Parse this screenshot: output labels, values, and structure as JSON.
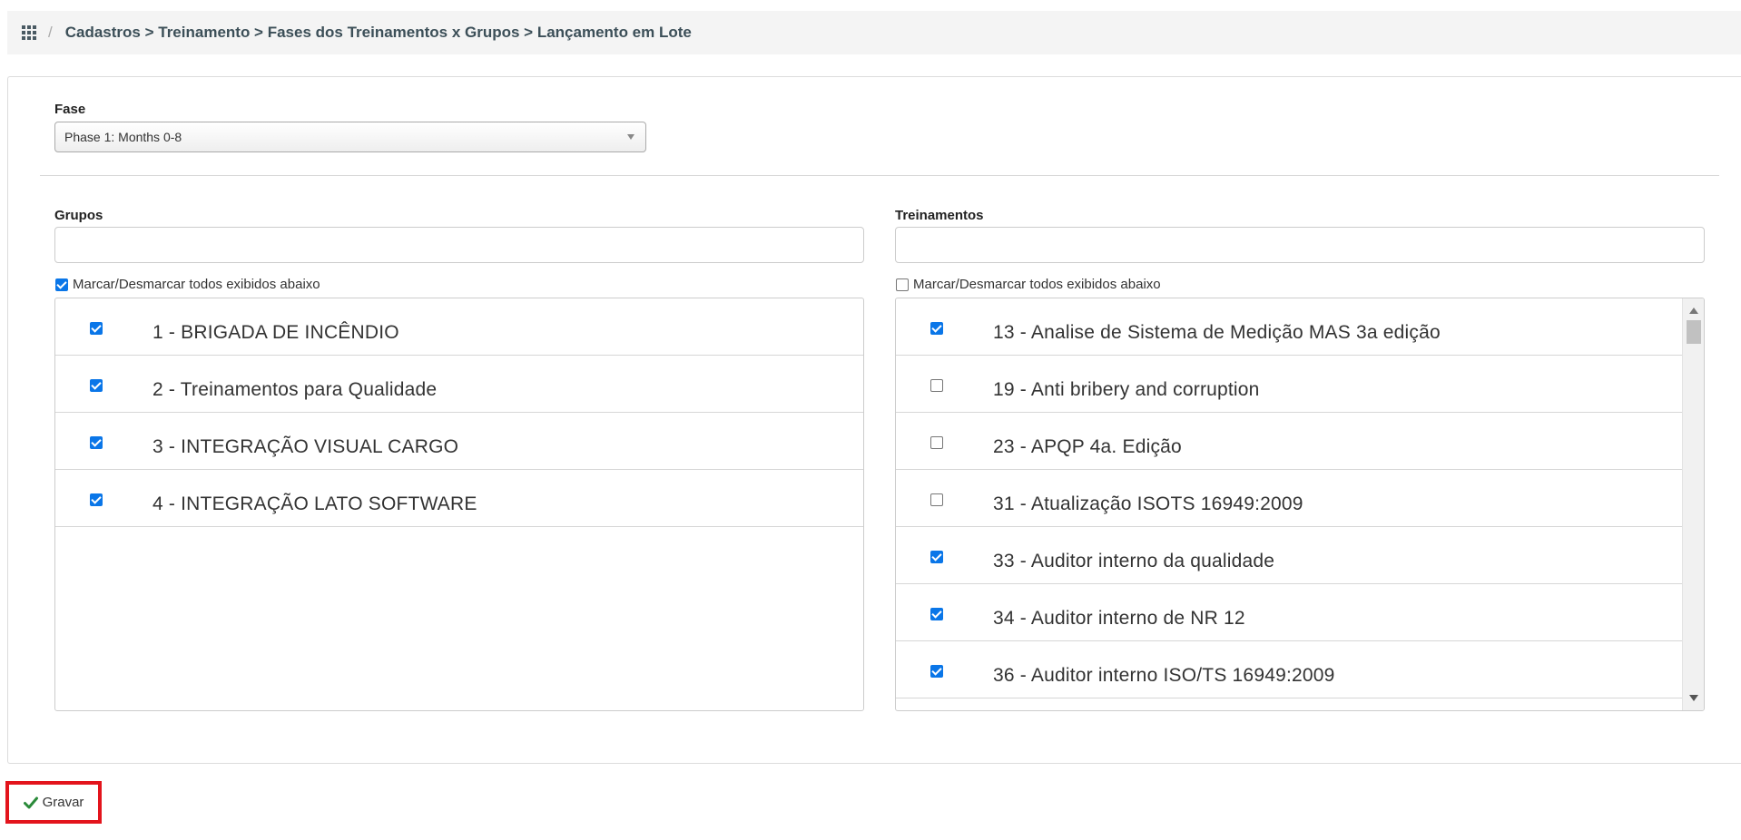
{
  "breadcrumb": {
    "text": "Cadastros > Treinamento > Fases dos Treinamentos x Grupos > Lançamento em Lote",
    "separator": "/"
  },
  "form": {
    "fase_label": "Fase",
    "fase_value": "Phase 1: Months 0-8",
    "grupos": {
      "label": "Grupos",
      "search_value": "",
      "toggle_all_label": "Marcar/Desmarcar todos exibidos abaixo",
      "toggle_all_checked": true,
      "items": [
        {
          "label": "1 - BRIGADA DE INCÊNDIO",
          "checked": true
        },
        {
          "label": "2 - Treinamentos para Qualidade",
          "checked": true
        },
        {
          "label": "3 - INTEGRAÇÃO VISUAL CARGO",
          "checked": true
        },
        {
          "label": "4 - INTEGRAÇÃO LATO SOFTWARE",
          "checked": true
        }
      ]
    },
    "treinamentos": {
      "label": "Treinamentos",
      "search_value": "",
      "toggle_all_label": "Marcar/Desmarcar todos exibidos abaixo",
      "toggle_all_checked": false,
      "items": [
        {
          "label": "13 - Analise de Sistema de Medição MAS 3a edição",
          "checked": true
        },
        {
          "label": "19 - Anti bribery and corruption",
          "checked": false
        },
        {
          "label": "23 - APQP 4a. Edição",
          "checked": false
        },
        {
          "label": "31 - Atualização ISOTS 16949:2009",
          "checked": false
        },
        {
          "label": "33 - Auditor interno da qualidade",
          "checked": true
        },
        {
          "label": "34 - Auditor interno de NR 12",
          "checked": true
        },
        {
          "label": "36 - Auditor interno ISO/TS 16949:2009",
          "checked": true
        }
      ]
    }
  },
  "actions": {
    "save_label": "Gravar"
  },
  "colors": {
    "checkbox_accent": "#0a76e8",
    "highlight_border": "#e3141c"
  }
}
